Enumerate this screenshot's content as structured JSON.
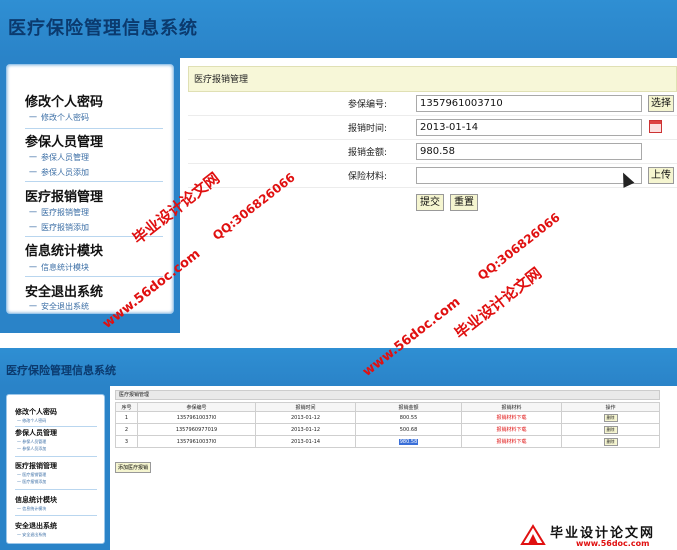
{
  "top": {
    "app_title": "医疗保险管理信息系统",
    "sidebar": [
      {
        "group": "修改个人密码",
        "items": [
          "修改个人密码"
        ]
      },
      {
        "group": "参保人员管理",
        "items": [
          "参保人员管理",
          "参保人员添加"
        ]
      },
      {
        "group": "医疗报销管理",
        "items": [
          "医疗报销管理",
          "医疗报销添加"
        ]
      },
      {
        "group": "信息统计模块",
        "items": [
          "信息统计模块"
        ]
      },
      {
        "group": "安全退出系统",
        "items": [
          "安全退出系统"
        ]
      }
    ],
    "form": {
      "heading": "医疗报销管理",
      "fields": [
        {
          "label": "参保编号:",
          "value": "1357961003710"
        },
        {
          "label": "报销时间:",
          "value": "2013-01-14"
        },
        {
          "label": "报销金额:",
          "value": "980.58"
        },
        {
          "label": "保险材料:",
          "value": ""
        }
      ],
      "select_button": "选择",
      "upload_button": "上传",
      "submit_button": "提交",
      "reset_button": "重置"
    }
  },
  "bottom": {
    "app_title": "医疗保险管理信息系统",
    "sidebar": [
      {
        "group": "修改个人密码",
        "items": [
          "修改个人密码"
        ]
      },
      {
        "group": "参保人员管理",
        "items": [
          "参保人员管理",
          "参保人员添加"
        ]
      },
      {
        "group": "医疗报销管理",
        "items": [
          "医疗报销管理",
          "医疗报销添加"
        ]
      },
      {
        "group": "信息统计模块",
        "items": [
          "信息统计模块"
        ]
      },
      {
        "group": "安全退出系统",
        "items": [
          "安全退出系统"
        ]
      }
    ],
    "table": {
      "heading": "医疗报销管理",
      "columns": [
        "序号",
        "参保编号",
        "报销时间",
        "报销金额",
        "报销材料",
        "操作"
      ],
      "rows": [
        {
          "no": "1",
          "id": "13579610037l0",
          "date": "2013-01-12",
          "amount": "800.55",
          "material": "报销材料下载",
          "op": "删除"
        },
        {
          "no": "2",
          "id": "1357960977019",
          "date": "2013-01-12",
          "amount": "500.68",
          "material": "报销材料下载",
          "op": "删除"
        },
        {
          "no": "3",
          "id": "13579610037l0",
          "date": "2013-01-14",
          "amount": "980.58",
          "material": "报销材料下载",
          "op": "删除"
        }
      ],
      "add_button": "添加医疗报销"
    }
  },
  "watermarks": {
    "site_cn": "毕业设计论文网",
    "url": "www.56doc.com",
    "qq": "QQ:306826066"
  },
  "logo": {
    "text": "毕业设计论文网",
    "url": "www.56doc.com"
  },
  "colors": {
    "header_blue": "#2a83c8",
    "watermark_red": "#e01010",
    "form_head_bg": "#f7f7d8"
  }
}
